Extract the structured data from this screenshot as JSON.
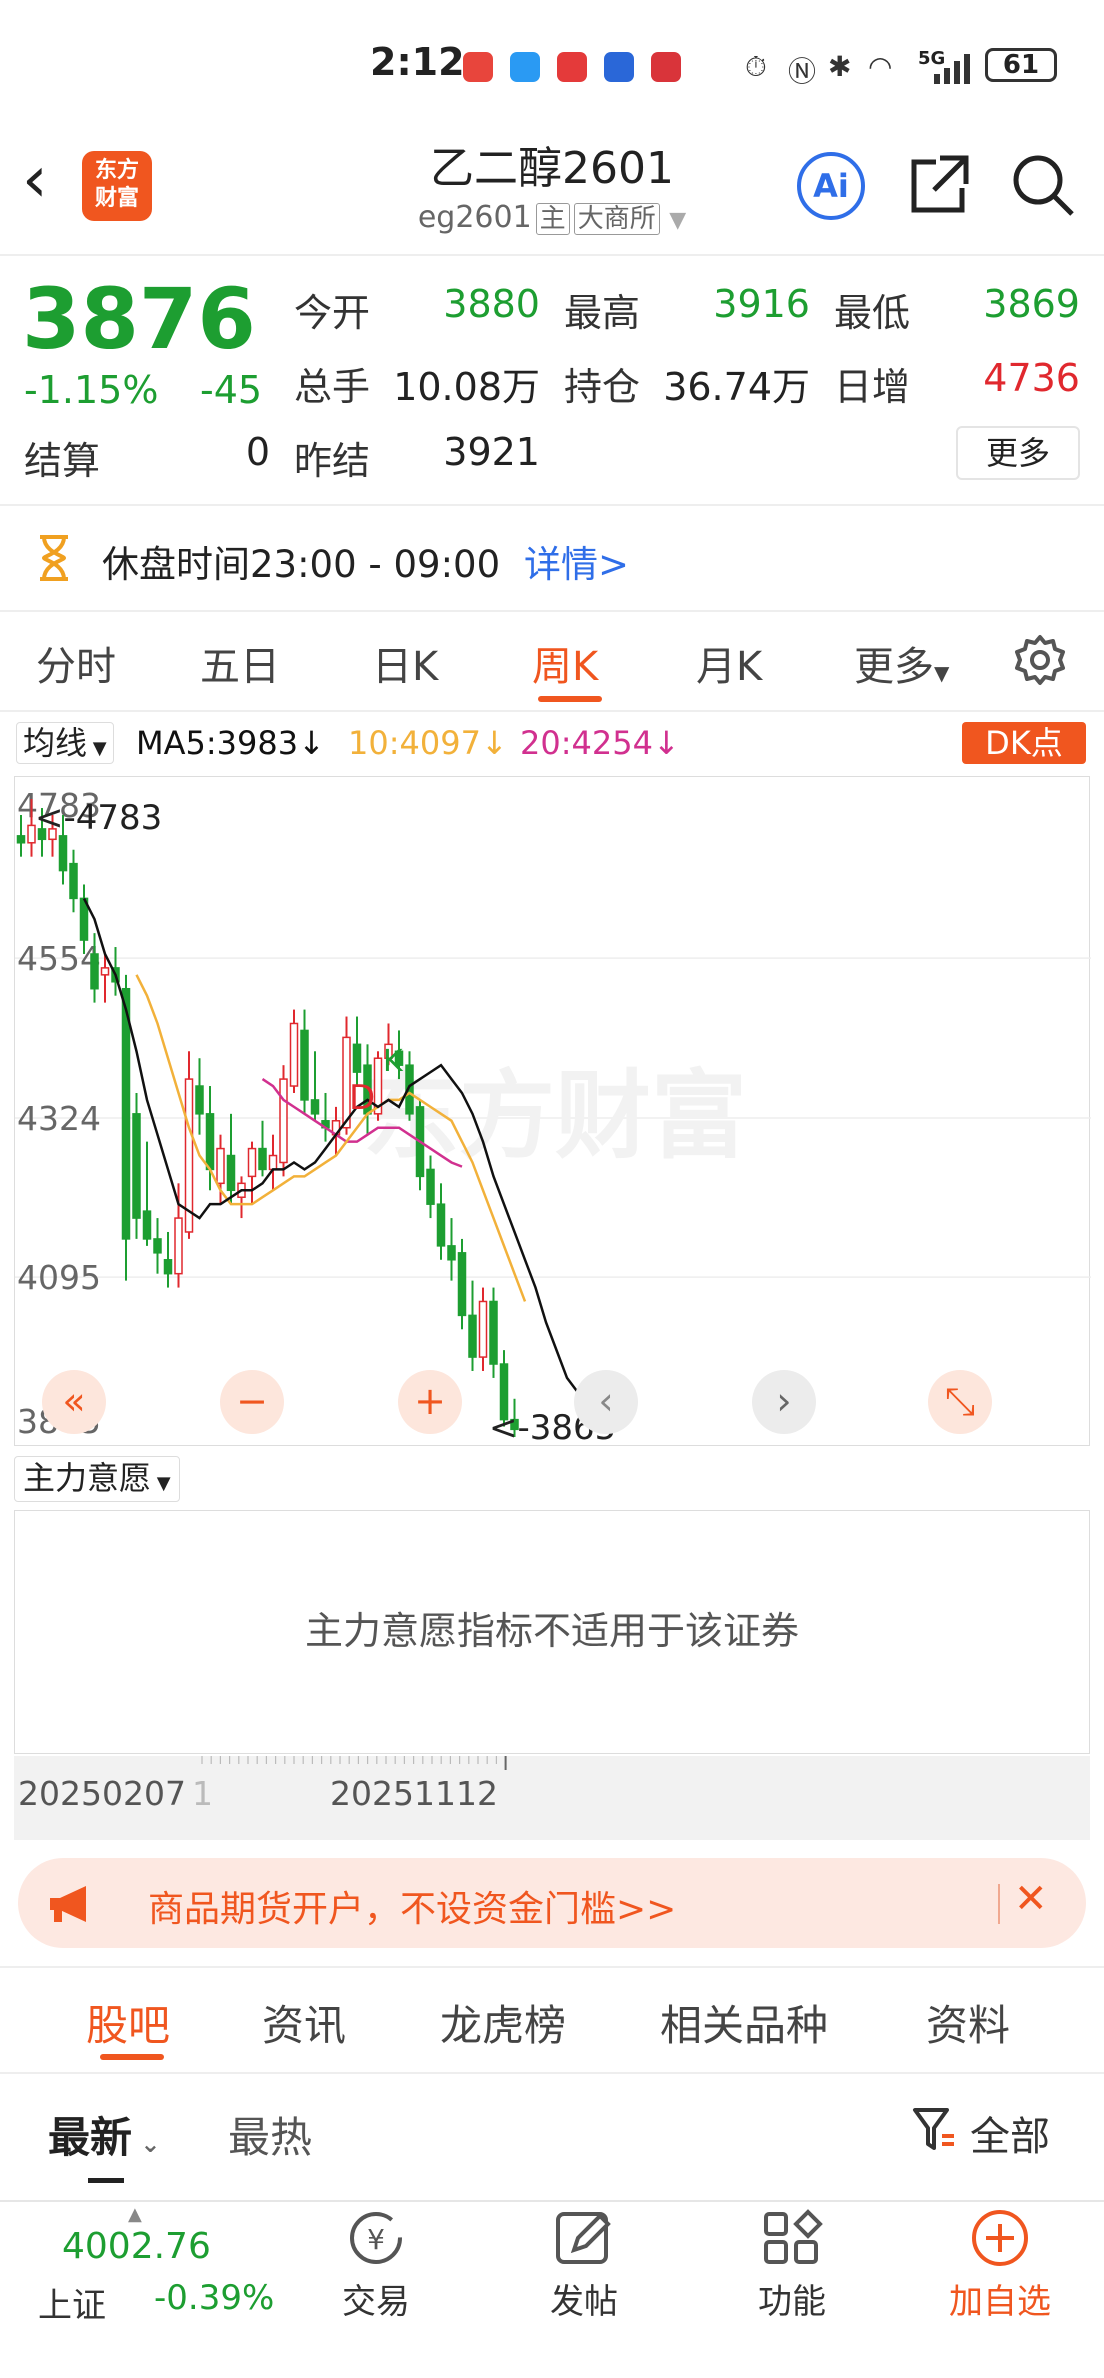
{
  "status_bar": {
    "time": "2:12",
    "battery": "61",
    "network": "5G"
  },
  "header": {
    "back_icon": "‹",
    "logo_text": "东方财富",
    "title": "乙二醇2601",
    "code": "eg2601",
    "tag1": "主",
    "tag2": "大商所",
    "ai_label": "Ai"
  },
  "quote": {
    "price": "3876",
    "change_pct": "-1.15%",
    "change": "-45",
    "open_label": "今开",
    "open": "3880",
    "high_label": "最高",
    "high": "3916",
    "low_label": "最低",
    "low": "3869",
    "volume_label": "总手",
    "volume": "10.08万",
    "oi_label": "持仓",
    "oi": "36.74万",
    "daily_inc_label": "日增",
    "daily_inc": "4736",
    "settle_label": "结算",
    "settle": "0",
    "prev_settle_label": "昨结",
    "prev_settle": "3921",
    "more_label": "更多"
  },
  "notice": {
    "text": "休盘时间23:00 - 09:00",
    "link": "详情>"
  },
  "chart_tabs": [
    "分时",
    "五日",
    "日K",
    "周K",
    "月K",
    "更多"
  ],
  "active_chart_tab": "周K",
  "ma": {
    "selector": "均线",
    "ma5": "MA5:3983↓",
    "ma10": "10:4097↓",
    "ma20": "20:4254↓",
    "dk": "DK点"
  },
  "colors": {
    "accent": "#f0561f",
    "up": "#e0282e",
    "down": "#1d9e31",
    "ma5": "#111111",
    "ma10": "#f2b13a",
    "ma20": "#d1308f"
  },
  "chart_data": {
    "type": "candlestick",
    "period": "weekly",
    "y_ticks": [
      "4783",
      "4554",
      "4324",
      "4095",
      "3865"
    ],
    "ylim": [
      3865,
      4783
    ],
    "max_marker": "<-4783",
    "min_marker": "<-3865",
    "dk_labels": [
      "D",
      "K"
    ],
    "watermark": "东方财富",
    "x_labels": [
      "20250207",
      "20251112"
    ],
    "candles": [
      {
        "o": 4730,
        "h": 4760,
        "l": 4700,
        "c": 4720
      },
      {
        "o": 4720,
        "h": 4783,
        "l": 4700,
        "c": 4745
      },
      {
        "o": 4740,
        "h": 4770,
        "l": 4700,
        "c": 4725
      },
      {
        "o": 4725,
        "h": 4760,
        "l": 4700,
        "c": 4740
      },
      {
        "o": 4730,
        "h": 4760,
        "l": 4660,
        "c": 4680
      },
      {
        "o": 4690,
        "h": 4710,
        "l": 4620,
        "c": 4640
      },
      {
        "o": 4640,
        "h": 4660,
        "l": 4560,
        "c": 4580
      },
      {
        "o": 4560,
        "h": 4590,
        "l": 4490,
        "c": 4510
      },
      {
        "o": 4530,
        "h": 4560,
        "l": 4490,
        "c": 4540
      },
      {
        "o": 4540,
        "h": 4570,
        "l": 4500,
        "c": 4520
      },
      {
        "o": 4510,
        "h": 4530,
        "l": 4090,
        "c": 4150
      },
      {
        "o": 4330,
        "h": 4360,
        "l": 4150,
        "c": 4180
      },
      {
        "o": 4190,
        "h": 4290,
        "l": 4140,
        "c": 4150
      },
      {
        "o": 4150,
        "h": 4180,
        "l": 4100,
        "c": 4130
      },
      {
        "o": 4120,
        "h": 4160,
        "l": 4080,
        "c": 4100
      },
      {
        "o": 4100,
        "h": 4230,
        "l": 4080,
        "c": 4180
      },
      {
        "o": 4160,
        "h": 4420,
        "l": 4150,
        "c": 4380
      },
      {
        "o": 4370,
        "h": 4410,
        "l": 4300,
        "c": 4330
      },
      {
        "o": 4330,
        "h": 4370,
        "l": 4220,
        "c": 4250
      },
      {
        "o": 4230,
        "h": 4300,
        "l": 4200,
        "c": 4280
      },
      {
        "o": 4270,
        "h": 4330,
        "l": 4200,
        "c": 4220
      },
      {
        "o": 4210,
        "h": 4240,
        "l": 4180,
        "c": 4230
      },
      {
        "o": 4240,
        "h": 4290,
        "l": 4200,
        "c": 4280
      },
      {
        "o": 4280,
        "h": 4320,
        "l": 4240,
        "c": 4250
      },
      {
        "o": 4250,
        "h": 4300,
        "l": 4220,
        "c": 4270
      },
      {
        "o": 4260,
        "h": 4400,
        "l": 4240,
        "c": 4380
      },
      {
        "o": 4370,
        "h": 4480,
        "l": 4360,
        "c": 4460
      },
      {
        "o": 4450,
        "h": 4480,
        "l": 4330,
        "c": 4350
      },
      {
        "o": 4350,
        "h": 4420,
        "l": 4320,
        "c": 4330
      },
      {
        "o": 4320,
        "h": 4360,
        "l": 4290,
        "c": 4310
      },
      {
        "o": 4300,
        "h": 4340,
        "l": 4270,
        "c": 4320
      },
      {
        "o": 4310,
        "h": 4470,
        "l": 4300,
        "c": 4440
      },
      {
        "o": 4430,
        "h": 4470,
        "l": 4370,
        "c": 4390
      },
      {
        "o": 4400,
        "h": 4430,
        "l": 4300,
        "c": 4330
      },
      {
        "o": 4330,
        "h": 4420,
        "l": 4320,
        "c": 4410
      },
      {
        "o": 4410,
        "h": 4460,
        "l": 4400,
        "c": 4430
      },
      {
        "o": 4420,
        "h": 4450,
        "l": 4380,
        "c": 4400
      },
      {
        "o": 4400,
        "h": 4420,
        "l": 4320,
        "c": 4330
      },
      {
        "o": 4340,
        "h": 4350,
        "l": 4220,
        "c": 4240
      },
      {
        "o": 4250,
        "h": 4270,
        "l": 4180,
        "c": 4200
      },
      {
        "o": 4200,
        "h": 4230,
        "l": 4120,
        "c": 4140
      },
      {
        "o": 4140,
        "h": 4180,
        "l": 4090,
        "c": 4120
      },
      {
        "o": 4130,
        "h": 4150,
        "l": 4020,
        "c": 4040
      },
      {
        "o": 4040,
        "h": 4090,
        "l": 3960,
        "c": 3980
      },
      {
        "o": 3980,
        "h": 4080,
        "l": 3960,
        "c": 4060
      },
      {
        "o": 4060,
        "h": 4080,
        "l": 3950,
        "c": 3970
      },
      {
        "o": 3970,
        "h": 3990,
        "l": 3880,
        "c": 3890
      },
      {
        "o": 3890,
        "h": 3920,
        "l": 3865,
        "c": 3876
      }
    ],
    "ma5_start": 6,
    "ma5": [
      4640,
      4610,
      4560,
      4530,
      4480,
      4420,
      4350,
      4300,
      4250,
      4200,
      4190,
      4180,
      4200,
      4200,
      4210,
      4220,
      4220,
      4230,
      4250,
      4250,
      4260,
      4250,
      4260,
      4280,
      4300,
      4320,
      4340,
      4350,
      4340,
      4350,
      4340,
      4370,
      4380,
      4390,
      4400,
      4380,
      4360,
      4330,
      4290,
      4240,
      4200,
      4160,
      4120,
      4080,
      4030,
      3990,
      3950,
      3930
    ],
    "ma10_start": 11,
    "ma10": [
      4530,
      4500,
      4460,
      4410,
      4360,
      4310,
      4270,
      4250,
      4220,
      4200,
      4200,
      4200,
      4210,
      4220,
      4230,
      4240,
      4240,
      4250,
      4260,
      4270,
      4290,
      4310,
      4330,
      4340,
      4350,
      4350,
      4360,
      4350,
      4340,
      4330,
      4320,
      4290,
      4260,
      4220,
      4180,
      4140,
      4100,
      4060
    ],
    "ma20_start": 23,
    "ma20": [
      4380,
      4370,
      4350,
      4340,
      4330,
      4320,
      4310,
      4300,
      4290,
      4290,
      4300,
      4310,
      4310,
      4310,
      4300,
      4290,
      4280,
      4270,
      4260,
      4254
    ],
    "ma_plot_start_index": 0
  },
  "chart_controls": [
    "«",
    "−",
    "+",
    "‹",
    "›",
    "⤡"
  ],
  "indicator": {
    "selector": "主力意愿",
    "message": "主力意愿指标不适用于该证券"
  },
  "dates": {
    "start": "20250207",
    "end": "20251112",
    "cursor": "1"
  },
  "banner": {
    "text": "商品期货开户，不设资金门槛>>",
    "close": "✕"
  },
  "bottom_tabs": [
    "股吧",
    "资讯",
    "龙虎榜",
    "相关品种",
    "资料"
  ],
  "active_bottom_tab": "股吧",
  "filters": {
    "latest": "最新",
    "hot": "最热",
    "all": "全部"
  },
  "nav": {
    "index_value": "4002.76",
    "index_name": "上证",
    "index_change": "-0.39%",
    "items": [
      {
        "label": "交易",
        "icon": "trade-icon"
      },
      {
        "label": "发帖",
        "icon": "post-icon"
      },
      {
        "label": "功能",
        "icon": "function-icon"
      },
      {
        "label": "加自选",
        "icon": "add-watch-icon"
      }
    ]
  }
}
